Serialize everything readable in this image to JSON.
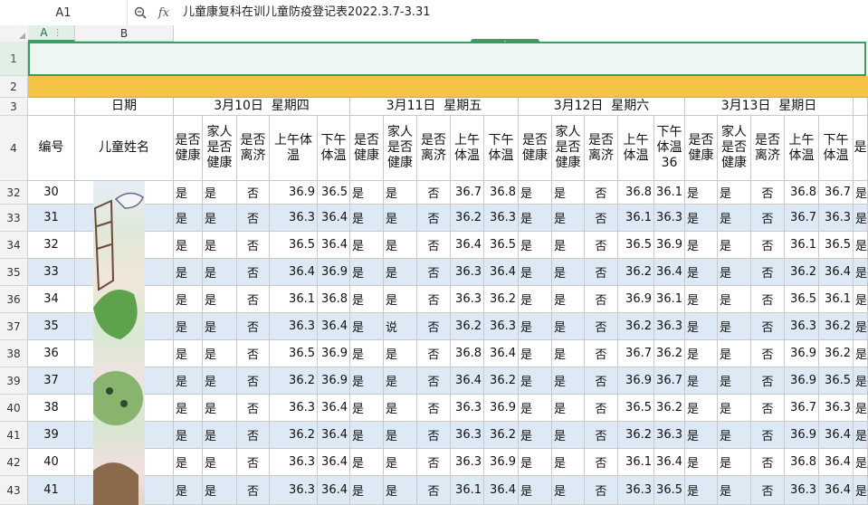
{
  "formula_bar": {
    "name_box": "A1",
    "zoom_icon": "zoom-icon",
    "fx_label": "fx",
    "formula": "儿童康复科在训儿童防疫登记表2022.3.7-3.31",
    "second_line": "'"
  },
  "columns": [
    "A",
    "B"
  ],
  "row_numbers": [
    "1",
    "2",
    "3",
    "4",
    "32",
    "33",
    "34",
    "35",
    "36",
    "37",
    "38",
    "39",
    "40",
    "41",
    "42",
    "43"
  ],
  "header": {
    "date_label": "日期",
    "id_label": "编号",
    "name_label": "儿童姓名",
    "days": [
      "3月10日  星期四",
      "3月11日  星期五",
      "3月12日  星期六",
      "3月13日  星期日"
    ],
    "day_cols": [
      [
        "是否健康",
        "家人是否健康",
        "是否离济",
        "上午体温",
        "下午体温"
      ],
      [
        "是否健康",
        "家人是否健康",
        "是否离济",
        "上午体温",
        "下午体温"
      ],
      [
        "是否健康",
        "家人是否健康",
        "是否离济",
        "上午体温",
        "下午体温36"
      ],
      [
        "是否健康",
        "家人是否健康",
        "是否离济",
        "上午体温",
        "下午体温"
      ]
    ],
    "partial_col": "是"
  },
  "rows": [
    {
      "id": "30",
      "vals": [
        "是",
        "是",
        "否",
        "36.9",
        "36.5",
        "是",
        "是",
        "否",
        "36.7",
        "36.8",
        "是",
        "是",
        "否",
        "36.8",
        "36.1",
        "是",
        "是",
        "否",
        "36.8",
        "36.7",
        "是"
      ]
    },
    {
      "id": "31",
      "vals": [
        "是",
        "是",
        "否",
        "36.3",
        "36.4",
        "是",
        "是",
        "否",
        "36.2",
        "36.3",
        "是",
        "是",
        "否",
        "36.1",
        "36.3",
        "是",
        "是",
        "否",
        "36.7",
        "36.3",
        "是"
      ]
    },
    {
      "id": "32",
      "vals": [
        "是",
        "是",
        "否",
        "36.5",
        "36.4",
        "是",
        "是",
        "否",
        "36.4",
        "36.5",
        "是",
        "是",
        "否",
        "36.5",
        "36.9",
        "是",
        "是",
        "否",
        "36.1",
        "36.5",
        "是"
      ]
    },
    {
      "id": "33",
      "vals": [
        "是",
        "是",
        "否",
        "36.4",
        "36.9",
        "是",
        "是",
        "否",
        "36.3",
        "36.4",
        "是",
        "是",
        "否",
        "36.2",
        "36.4",
        "是",
        "是",
        "否",
        "36.2",
        "36.4",
        "是"
      ]
    },
    {
      "id": "34",
      "vals": [
        "是",
        "是",
        "否",
        "36.1",
        "36.8",
        "是",
        "是",
        "否",
        "36.3",
        "36.2",
        "是",
        "是",
        "否",
        "36.9",
        "36.1",
        "是",
        "是",
        "否",
        "36.5",
        "36.1",
        "是"
      ]
    },
    {
      "id": "35",
      "vals": [
        "是",
        "是",
        "否",
        "36.3",
        "36.4",
        "是",
        "说",
        "否",
        "36.2",
        "36.3",
        "是",
        "是",
        "否",
        "36.2",
        "36.3",
        "是",
        "是",
        "否",
        "36.3",
        "36.2",
        "是"
      ]
    },
    {
      "id": "36",
      "vals": [
        "是",
        "是",
        "否",
        "36.5",
        "36.9",
        "是",
        "是",
        "否",
        "36.8",
        "36.4",
        "是",
        "是",
        "否",
        "36.7",
        "36.2",
        "是",
        "是",
        "否",
        "36.9",
        "36.2",
        "是"
      ]
    },
    {
      "id": "37",
      "vals": [
        "是",
        "是",
        "否",
        "36.2",
        "36.9",
        "是",
        "是",
        "否",
        "36.4",
        "36.2",
        "是",
        "是",
        "否",
        "36.9",
        "36.7",
        "是",
        "是",
        "否",
        "36.9",
        "36.5",
        "是"
      ]
    },
    {
      "id": "38",
      "vals": [
        "是",
        "是",
        "否",
        "36.3",
        "36.4",
        "是",
        "是",
        "否",
        "36.3",
        "36.9",
        "是",
        "是",
        "否",
        "36.5",
        "36.2",
        "是",
        "是",
        "否",
        "36.7",
        "36.3",
        "是"
      ]
    },
    {
      "id": "39",
      "vals": [
        "是",
        "是",
        "否",
        "36.2",
        "36.4",
        "是",
        "是",
        "否",
        "36.3",
        "36.2",
        "是",
        "是",
        "否",
        "36.2",
        "36.3",
        "是",
        "是",
        "否",
        "36.9",
        "36.4",
        "是"
      ]
    },
    {
      "id": "40",
      "vals": [
        "是",
        "是",
        "否",
        "36.3",
        "36.4",
        "是",
        "是",
        "否",
        "36.3",
        "36.9",
        "是",
        "是",
        "否",
        "36.1",
        "36.4",
        "是",
        "是",
        "否",
        "36.8",
        "36.4",
        "是"
      ]
    },
    {
      "id": "41",
      "vals": [
        "是",
        "是",
        "否",
        "36.3",
        "36.4",
        "是",
        "是",
        "否",
        "36.1",
        "36.4",
        "是",
        "是",
        "否",
        "36.3",
        "36.5",
        "是",
        "是",
        "否",
        "36.3",
        "36.4",
        "是"
      ]
    }
  ],
  "colors": {
    "accent": "#3c9a63",
    "row2_fill": "#f6c346",
    "band_a": "#ffffff",
    "band_b": "#dde9f5"
  }
}
